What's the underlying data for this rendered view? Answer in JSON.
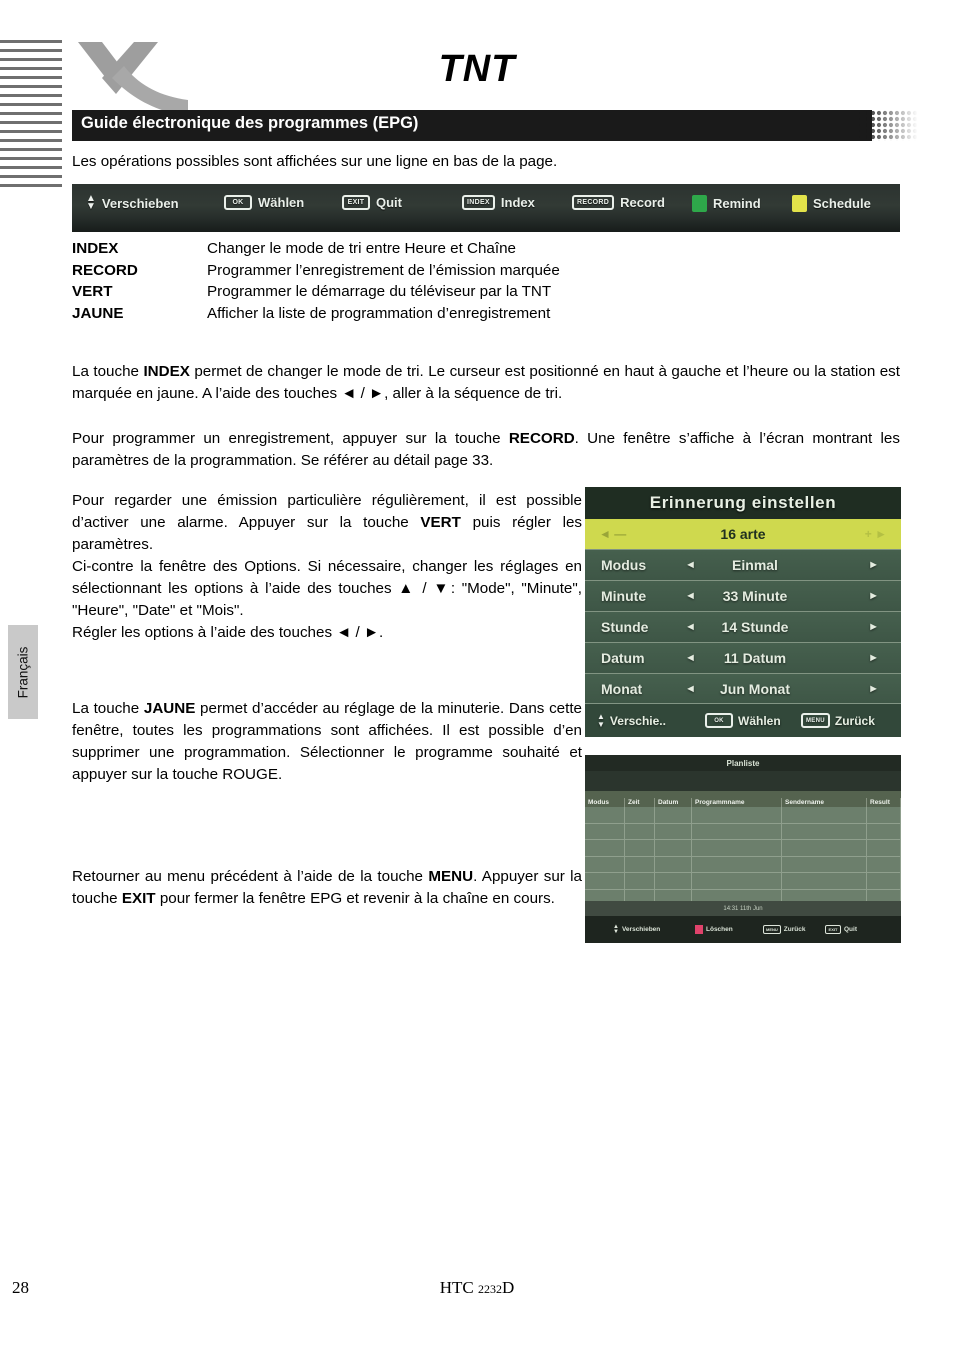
{
  "document": {
    "title": "TNT",
    "section_title": "Guide électronique des programmes (EPG)",
    "intro": "Les opérations possibles sont affichées sur une ligne en bas de la page.",
    "language_tab": "Français",
    "page_number": "28",
    "footer_model_prefix": "HTC ",
    "footer_model_number": "2232",
    "footer_model_suffix": "D"
  },
  "toolbar": {
    "items": [
      {
        "icon": "updown-arrows-icon",
        "key": "",
        "label": "Verschieben",
        "type": "arrows"
      },
      {
        "icon": "ok-key-icon",
        "key": "OK",
        "label": "Wählen",
        "type": "key"
      },
      {
        "icon": "exit-key-icon",
        "key": "EXIT",
        "label": "Quit",
        "type": "key"
      },
      {
        "icon": "index-key-icon",
        "key": "INDEX",
        "label": "Index",
        "type": "key"
      },
      {
        "icon": "record-key-icon",
        "key": "RECORD",
        "label": "Record",
        "type": "key"
      },
      {
        "icon": "green-color-key-icon",
        "key": "",
        "label": "Remind",
        "type": "color",
        "color": "#2ea84a"
      },
      {
        "icon": "yellow-color-key-icon",
        "key": "",
        "label": "Schedule",
        "type": "color",
        "color": "#e2e24a"
      }
    ]
  },
  "key_legend": [
    {
      "key": "INDEX",
      "desc": "Changer le mode de tri entre Heure et Chaîne"
    },
    {
      "key": "RECORD",
      "desc": "Programmer l’enregistrement de l’émission marquée"
    },
    {
      "key": "VERT",
      "desc": "Programmer le démarrage du téléviseur par la TNT"
    },
    {
      "key": "JAUNE",
      "desc": "Afficher la liste de programmation d’enregistrement"
    }
  ],
  "paragraphs": {
    "index_p1": "La touche ",
    "index_b1": "INDEX",
    "index_p2": " permet de changer le mode de tri. Le curseur est positionné en haut à gauche et l’heure ou la station est marquée en jaune. A l’aide des touches ◄ / ►, aller à la séquence de tri.",
    "record_p1": "Pour programmer un enregistrement, appuyer sur la touche ",
    "record_b1": "RECORD",
    "record_p2": ". Une fenêtre s’affiche à l’écran montrant les paramètres de la programmation. Se référer au détail page 33.",
    "vert_p1": "Pour regarder une émission particulière régulièrement, il est possible d’activer une alarme. Appuyer sur la touche ",
    "vert_b1": "VERT",
    "vert_p2": " puis régler les paramètres.",
    "vert_p3": "Ci-contre la fenêtre des Options. Si nécessaire, changer les réglages en sélectionnant les options à l’aide des touches ▲ / ▼: \"Mode\", \"Minute\", \"Heure\", \"Date\" et \"Mois\".",
    "vert_p4": "Régler les options à l’aide des touches ◄ / ►.",
    "jaune_p1": "La touche ",
    "jaune_b1": "JAUNE",
    "jaune_p2": " permet d’accéder au réglage de la minuterie. Dans cette fenêtre, toutes les programmations sont affichées. Il est possible d’en supprimer une programmation. Sélectionner le programme souhaité et appuyer sur la touche ROUGE.",
    "menu_p1": "Retourner au menu précédent à l’aide de la touche ",
    "menu_b1": "MENU",
    "menu_p2": ". Appuyer sur la touche ",
    "menu_b2": "EXIT",
    "menu_p3": " pour fermer la fenêtre EPG et revenir à la chaîne en cours."
  },
  "reminder_screen": {
    "title": "Erinnerung einstellen",
    "channel": "16 arte",
    "rows": [
      {
        "label": "Modus",
        "value": "Einmal"
      },
      {
        "label": "Minute",
        "value": "33 Minute"
      },
      {
        "label": "Stunde",
        "value": "14 Stunde"
      },
      {
        "label": "Datum",
        "value": "11 Datum"
      },
      {
        "label": "Monat",
        "value": "Jun Monat"
      }
    ],
    "footer": [
      {
        "icon": "updown-arrows-icon",
        "key": "",
        "label": "Verschie..",
        "type": "arrows"
      },
      {
        "icon": "ok-key-icon",
        "key": "OK",
        "label": "Wählen",
        "type": "key"
      },
      {
        "icon": "menu-key-icon",
        "key": "MENU",
        "label": "Zurück",
        "type": "key"
      }
    ],
    "highlight_color": "#cfd94e"
  },
  "planliste_screen": {
    "title": "Planliste",
    "columns": [
      "Modus",
      "Zeit",
      "Datum",
      "Programmname",
      "Sendername",
      "Result"
    ],
    "rows": [],
    "clock": "14:31 11th Jun",
    "footer": [
      {
        "icon": "updown-arrows-icon",
        "key": "",
        "label": "Verschieben",
        "type": "arrows"
      },
      {
        "icon": "red-color-key-icon",
        "key": "",
        "label": "Löschen",
        "type": "color",
        "color": "#e0436b"
      },
      {
        "icon": "menu-key-icon",
        "key": "MENU",
        "label": "Zurück",
        "type": "key"
      },
      {
        "icon": "exit-key-icon",
        "key": "EXIT",
        "label": "Quit",
        "type": "key"
      }
    ]
  }
}
